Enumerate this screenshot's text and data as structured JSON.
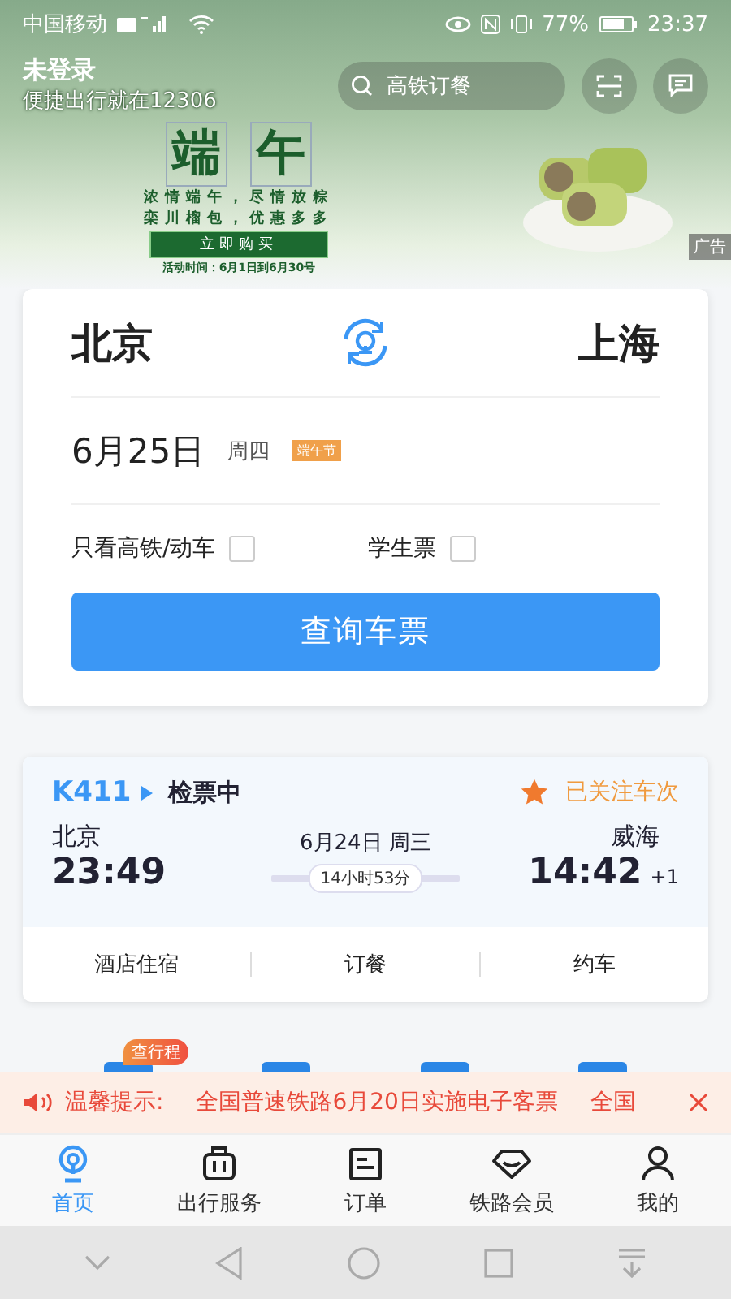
{
  "status_bar": {
    "carrier": "中国移动",
    "battery": "77%",
    "time": "23:37"
  },
  "header": {
    "title": "未登录",
    "subtitle": "便捷出行就在12306",
    "search": {
      "placeholder": "高铁订餐"
    }
  },
  "banner": {
    "title_chars": [
      "端",
      "午"
    ],
    "lines": [
      "浓情端午，尽情放粽",
      "栾川榴包，优惠多多"
    ],
    "button": "立即购买",
    "period": "活动时间：6月1日到6月30号",
    "ad_tag": "广告"
  },
  "search_card": {
    "from": "北京",
    "to": "上海",
    "date": "6月25日",
    "weekday": "周四",
    "holiday": "端午节",
    "options": [
      {
        "label": "只看高铁/动车",
        "checked": false
      },
      {
        "label": "学生票",
        "checked": false
      }
    ],
    "submit": "查询车票"
  },
  "trip": {
    "train": "K411",
    "status": "检票中",
    "follow": "已关注车次",
    "from": {
      "station": "北京",
      "time": "23:49"
    },
    "date": "6月24日 周三",
    "duration": "14小时53分",
    "to": {
      "station": "威海",
      "time": "14:42",
      "day_offset": "+1"
    },
    "actions": [
      "酒店住宿",
      "订餐",
      "约车"
    ]
  },
  "quick_entries": {
    "badge": "查行程"
  },
  "notice": {
    "label": "温馨提示:",
    "messages": [
      "全国普速铁路6月20日实施电子客票",
      "全国"
    ]
  },
  "tabs": [
    {
      "label": "首页",
      "selected": true
    },
    {
      "label": "出行服务",
      "selected": false
    },
    {
      "label": "订单",
      "selected": false
    },
    {
      "label": "铁路会员",
      "selected": false
    },
    {
      "label": "我的",
      "selected": false
    }
  ]
}
